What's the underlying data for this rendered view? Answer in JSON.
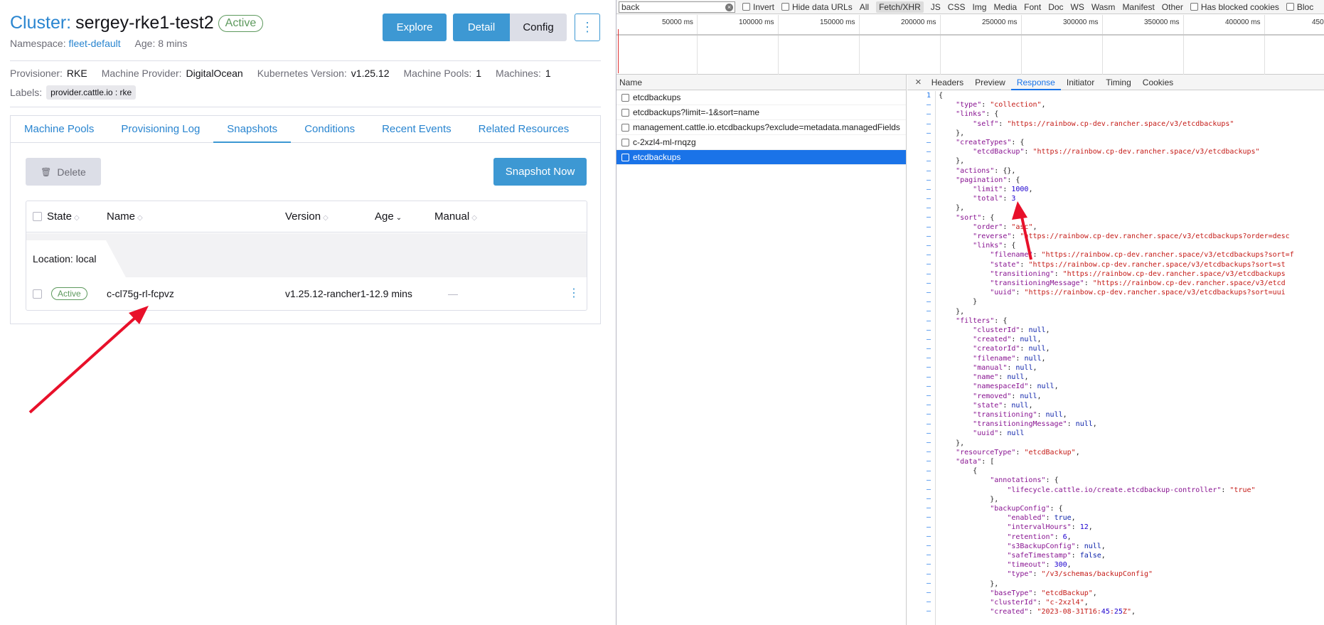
{
  "header": {
    "title_prefix": "Cluster:",
    "title_name": "sergey-rke1-test2",
    "status": "Active",
    "namespace_label": "Namespace:",
    "namespace_value": "fleet-default",
    "age": "Age: 8 mins",
    "explore_label": "Explore",
    "detail_label": "Detail",
    "config_label": "Config",
    "kebab": "⋮"
  },
  "meta": {
    "provisioner_label": "Provisioner:",
    "provisioner": "RKE",
    "machine_provider_label": "Machine Provider:",
    "machine_provider": "DigitalOcean",
    "k8s_label": "Kubernetes Version:",
    "k8s": "v1.25.12",
    "pools_label": "Machine Pools:",
    "pools": "1",
    "machines_label": "Machines:",
    "machines": "1",
    "labels_label": "Labels:",
    "label_tag": "provider.cattle.io : rke"
  },
  "tabs": [
    "Machine Pools",
    "Provisioning Log",
    "Snapshots",
    "Conditions",
    "Recent Events",
    "Related Resources"
  ],
  "actions": {
    "delete": "Delete",
    "snapshot_now": "Snapshot Now"
  },
  "table": {
    "columns": [
      "State",
      "Name",
      "Version",
      "Age",
      "Manual"
    ],
    "group": "Location: local",
    "rows": [
      {
        "state": "Active",
        "name": "c-cl75g-rl-fcpvz",
        "version": "v1.25.12-rancher1-1",
        "age": "2.9 mins",
        "manual": "—"
      }
    ]
  },
  "devtools": {
    "filter_value": "back",
    "filter_options": [
      "Invert",
      "Hide data URLs",
      "All",
      "Fetch/XHR",
      "JS",
      "CSS",
      "Img",
      "Media",
      "Font",
      "Doc",
      "WS",
      "Wasm",
      "Manifest",
      "Other",
      "Has blocked cookies",
      "Bloc"
    ],
    "timeline_ticks": [
      "50000 ms",
      "100000 ms",
      "150000 ms",
      "200000 ms",
      "250000 ms",
      "300000 ms",
      "350000 ms",
      "400000 ms",
      "450"
    ],
    "list_header": "Name",
    "requests": [
      "etcdbackups",
      "etcdbackups?limit=-1&sort=name",
      "management.cattle.io.etcdbackups?exclude=metadata.managedFields",
      "c-2xzl4-ml-rnqzg",
      "etcdbackups"
    ],
    "detail_tabs": [
      "Headers",
      "Preview",
      "Response",
      "Initiator",
      "Timing",
      "Cookies"
    ],
    "response_lines": [
      "{",
      "    \"type\": \"collection\",",
      "    \"links\": {",
      "        \"self\": \"https://rainbow.cp-dev.rancher.space/v3/etcdbackups\"",
      "    },",
      "    \"createTypes\": {",
      "        \"etcdBackup\": \"https://rainbow.cp-dev.rancher.space/v3/etcdbackups\"",
      "    },",
      "    \"actions\": {},",
      "    \"pagination\": {",
      "        \"limit\": 1000,",
      "        \"total\": 3",
      "    },",
      "    \"sort\": {",
      "        \"order\": \"asc\",",
      "        \"reverse\": \"https://rainbow.cp-dev.rancher.space/v3/etcdbackups?order=desc",
      "        \"links\": {",
      "            \"filename\": \"https://rainbow.cp-dev.rancher.space/v3/etcdbackups?sort=f",
      "            \"state\": \"https://rainbow.cp-dev.rancher.space/v3/etcdbackups?sort=st",
      "            \"transitioning\": \"https://rainbow.cp-dev.rancher.space/v3/etcdbackups",
      "            \"transitioningMessage\": \"https://rainbow.cp-dev.rancher.space/v3/etcd",
      "            \"uuid\": \"https://rainbow.cp-dev.rancher.space/v3/etcdbackups?sort=uui",
      "        }",
      "    },",
      "    \"filters\": {",
      "        \"clusterId\": null,",
      "        \"created\": null,",
      "        \"creatorId\": null,",
      "        \"filename\": null,",
      "        \"manual\": null,",
      "        \"name\": null,",
      "        \"namespaceId\": null,",
      "        \"removed\": null,",
      "        \"state\": null,",
      "        \"transitioning\": null,",
      "        \"transitioningMessage\": null,",
      "        \"uuid\": null",
      "    },",
      "    \"resourceType\": \"etcdBackup\",",
      "    \"data\": [",
      "        {",
      "            \"annotations\": {",
      "                \"lifecycle.cattle.io/create.etcdbackup-controller\": \"true\"",
      "            },",
      "            \"backupConfig\": {",
      "                \"enabled\": true,",
      "                \"intervalHours\": 12,",
      "                \"retention\": 6,",
      "                \"s3BackupConfig\": null,",
      "                \"safeTimestamp\": false,",
      "                \"timeout\": 300,",
      "                \"type\": \"/v3/schemas/backupConfig\"",
      "            },",
      "            \"baseType\": \"etcdBackup\",",
      "            \"clusterId\": \"c-2xzl4\",",
      "            \"created\": \"2023-08-31T16:45:25Z\","
    ]
  },
  "colors": {
    "link": "#2985d0",
    "primary": "#3d98d3",
    "active": "#5d995d",
    "arrow": "#e8102a",
    "selected": "#1a73e8"
  }
}
